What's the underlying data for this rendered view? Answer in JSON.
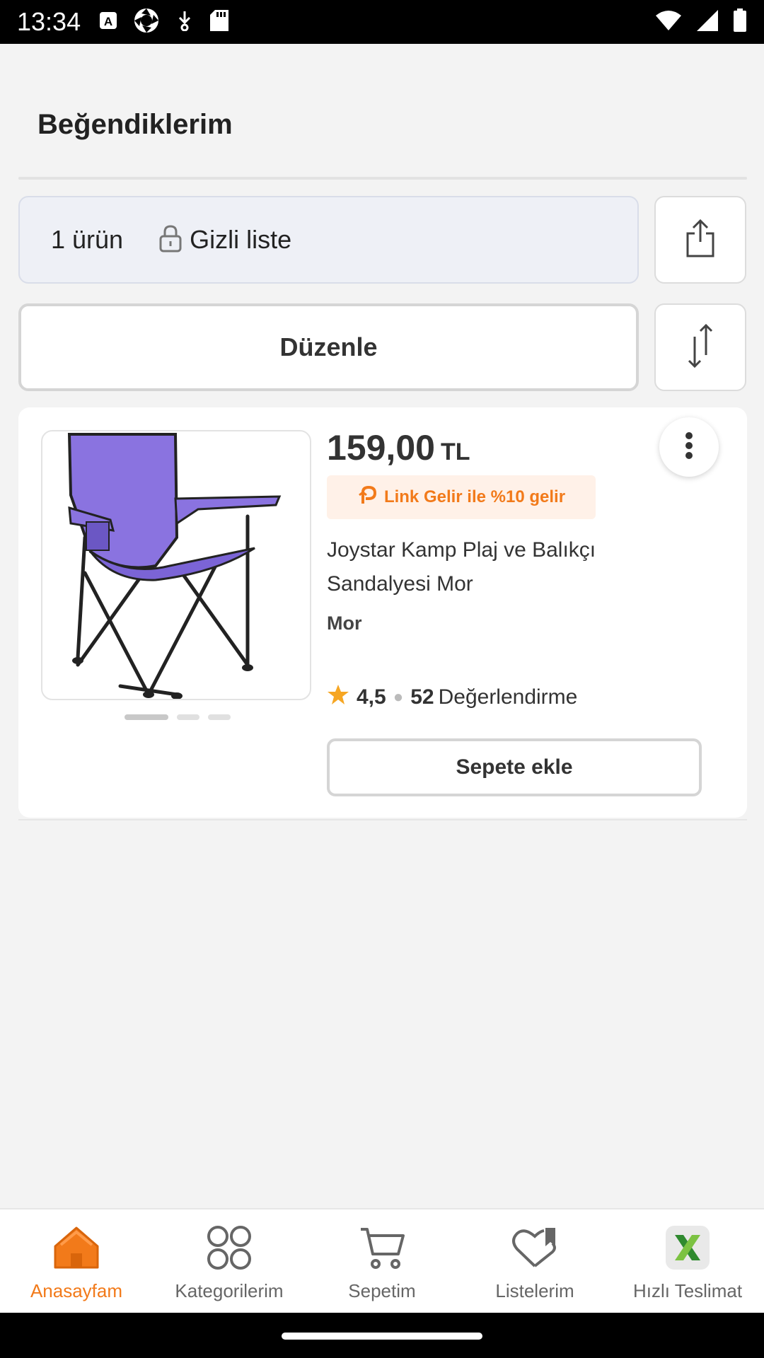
{
  "status_bar": {
    "time": "13:34"
  },
  "header": {
    "title": "Beğendiklerim"
  },
  "list_info": {
    "count": "1 ürün",
    "privacy": "Gizli liste"
  },
  "actions": {
    "edit_label": "Düzenle"
  },
  "product": {
    "price": "159,00",
    "currency": "TL",
    "promo": "Link Gelir ile %10 gelir",
    "title": "Joystar Kamp Plaj ve Balıkçı Sandalyesi Mor",
    "variant": "Mor",
    "rating": "4,5",
    "review_count": "52",
    "review_label": "Değerlendirme",
    "add_to_cart": "Sepete ekle",
    "image_dots": 3,
    "image_active_dot": 1
  },
  "bottom_nav": {
    "items": [
      {
        "label": "Anasayfam",
        "icon": "home-icon",
        "active": true
      },
      {
        "label": "Kategorilerim",
        "icon": "categories-icon",
        "active": false
      },
      {
        "label": "Sepetim",
        "icon": "cart-icon",
        "active": false
      },
      {
        "label": "Listelerim",
        "icon": "lists-heart-icon",
        "active": false
      },
      {
        "label": "Hızlı Teslimat",
        "icon": "fast-delivery-icon",
        "active": false
      }
    ]
  },
  "colors": {
    "accent": "#f27a1a",
    "product_purple": "#8a73e0"
  }
}
